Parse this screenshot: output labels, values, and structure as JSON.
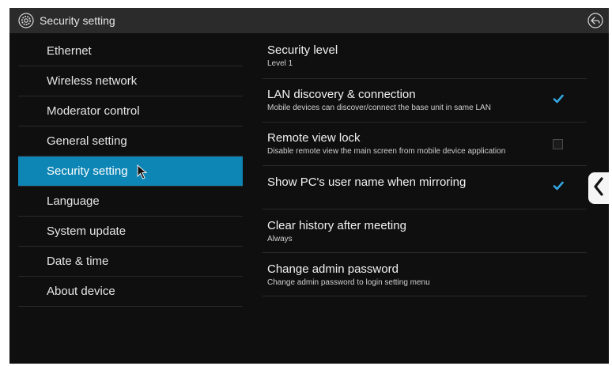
{
  "titlebar": {
    "title": "Security setting",
    "settings_icon": "gear-icon",
    "back_icon": "back-arrow-icon"
  },
  "sidebar": {
    "items": [
      {
        "label": "Ethernet"
      },
      {
        "label": "Wireless network"
      },
      {
        "label": "Moderator control"
      },
      {
        "label": "General setting"
      },
      {
        "label": "Security setting"
      },
      {
        "label": "Language"
      },
      {
        "label": "System update"
      },
      {
        "label": "Date & time"
      },
      {
        "label": "About device"
      }
    ],
    "active_index": 4
  },
  "settings": [
    {
      "title": "Security level",
      "subtitle": "Level 1"
    },
    {
      "title": "LAN discovery & connection",
      "subtitle": "Mobile devices can discover/connect the base unit in same LAN",
      "checked": true
    },
    {
      "title": "Remote view lock",
      "subtitle": "Disable remote view the main screen from mobile device application",
      "checked": false
    },
    {
      "title": "Show PC's user name when mirroring",
      "subtitle": "",
      "checked": true
    },
    {
      "title": "Clear history after meeting",
      "subtitle": "Always"
    },
    {
      "title": "Change admin password",
      "subtitle": "Change admin password to login setting menu"
    }
  ],
  "colors": {
    "accent": "#0e86b5",
    "checkmark": "#34a6e0",
    "background": "#0f0f0f",
    "titlebar": "#2b2b2b"
  }
}
